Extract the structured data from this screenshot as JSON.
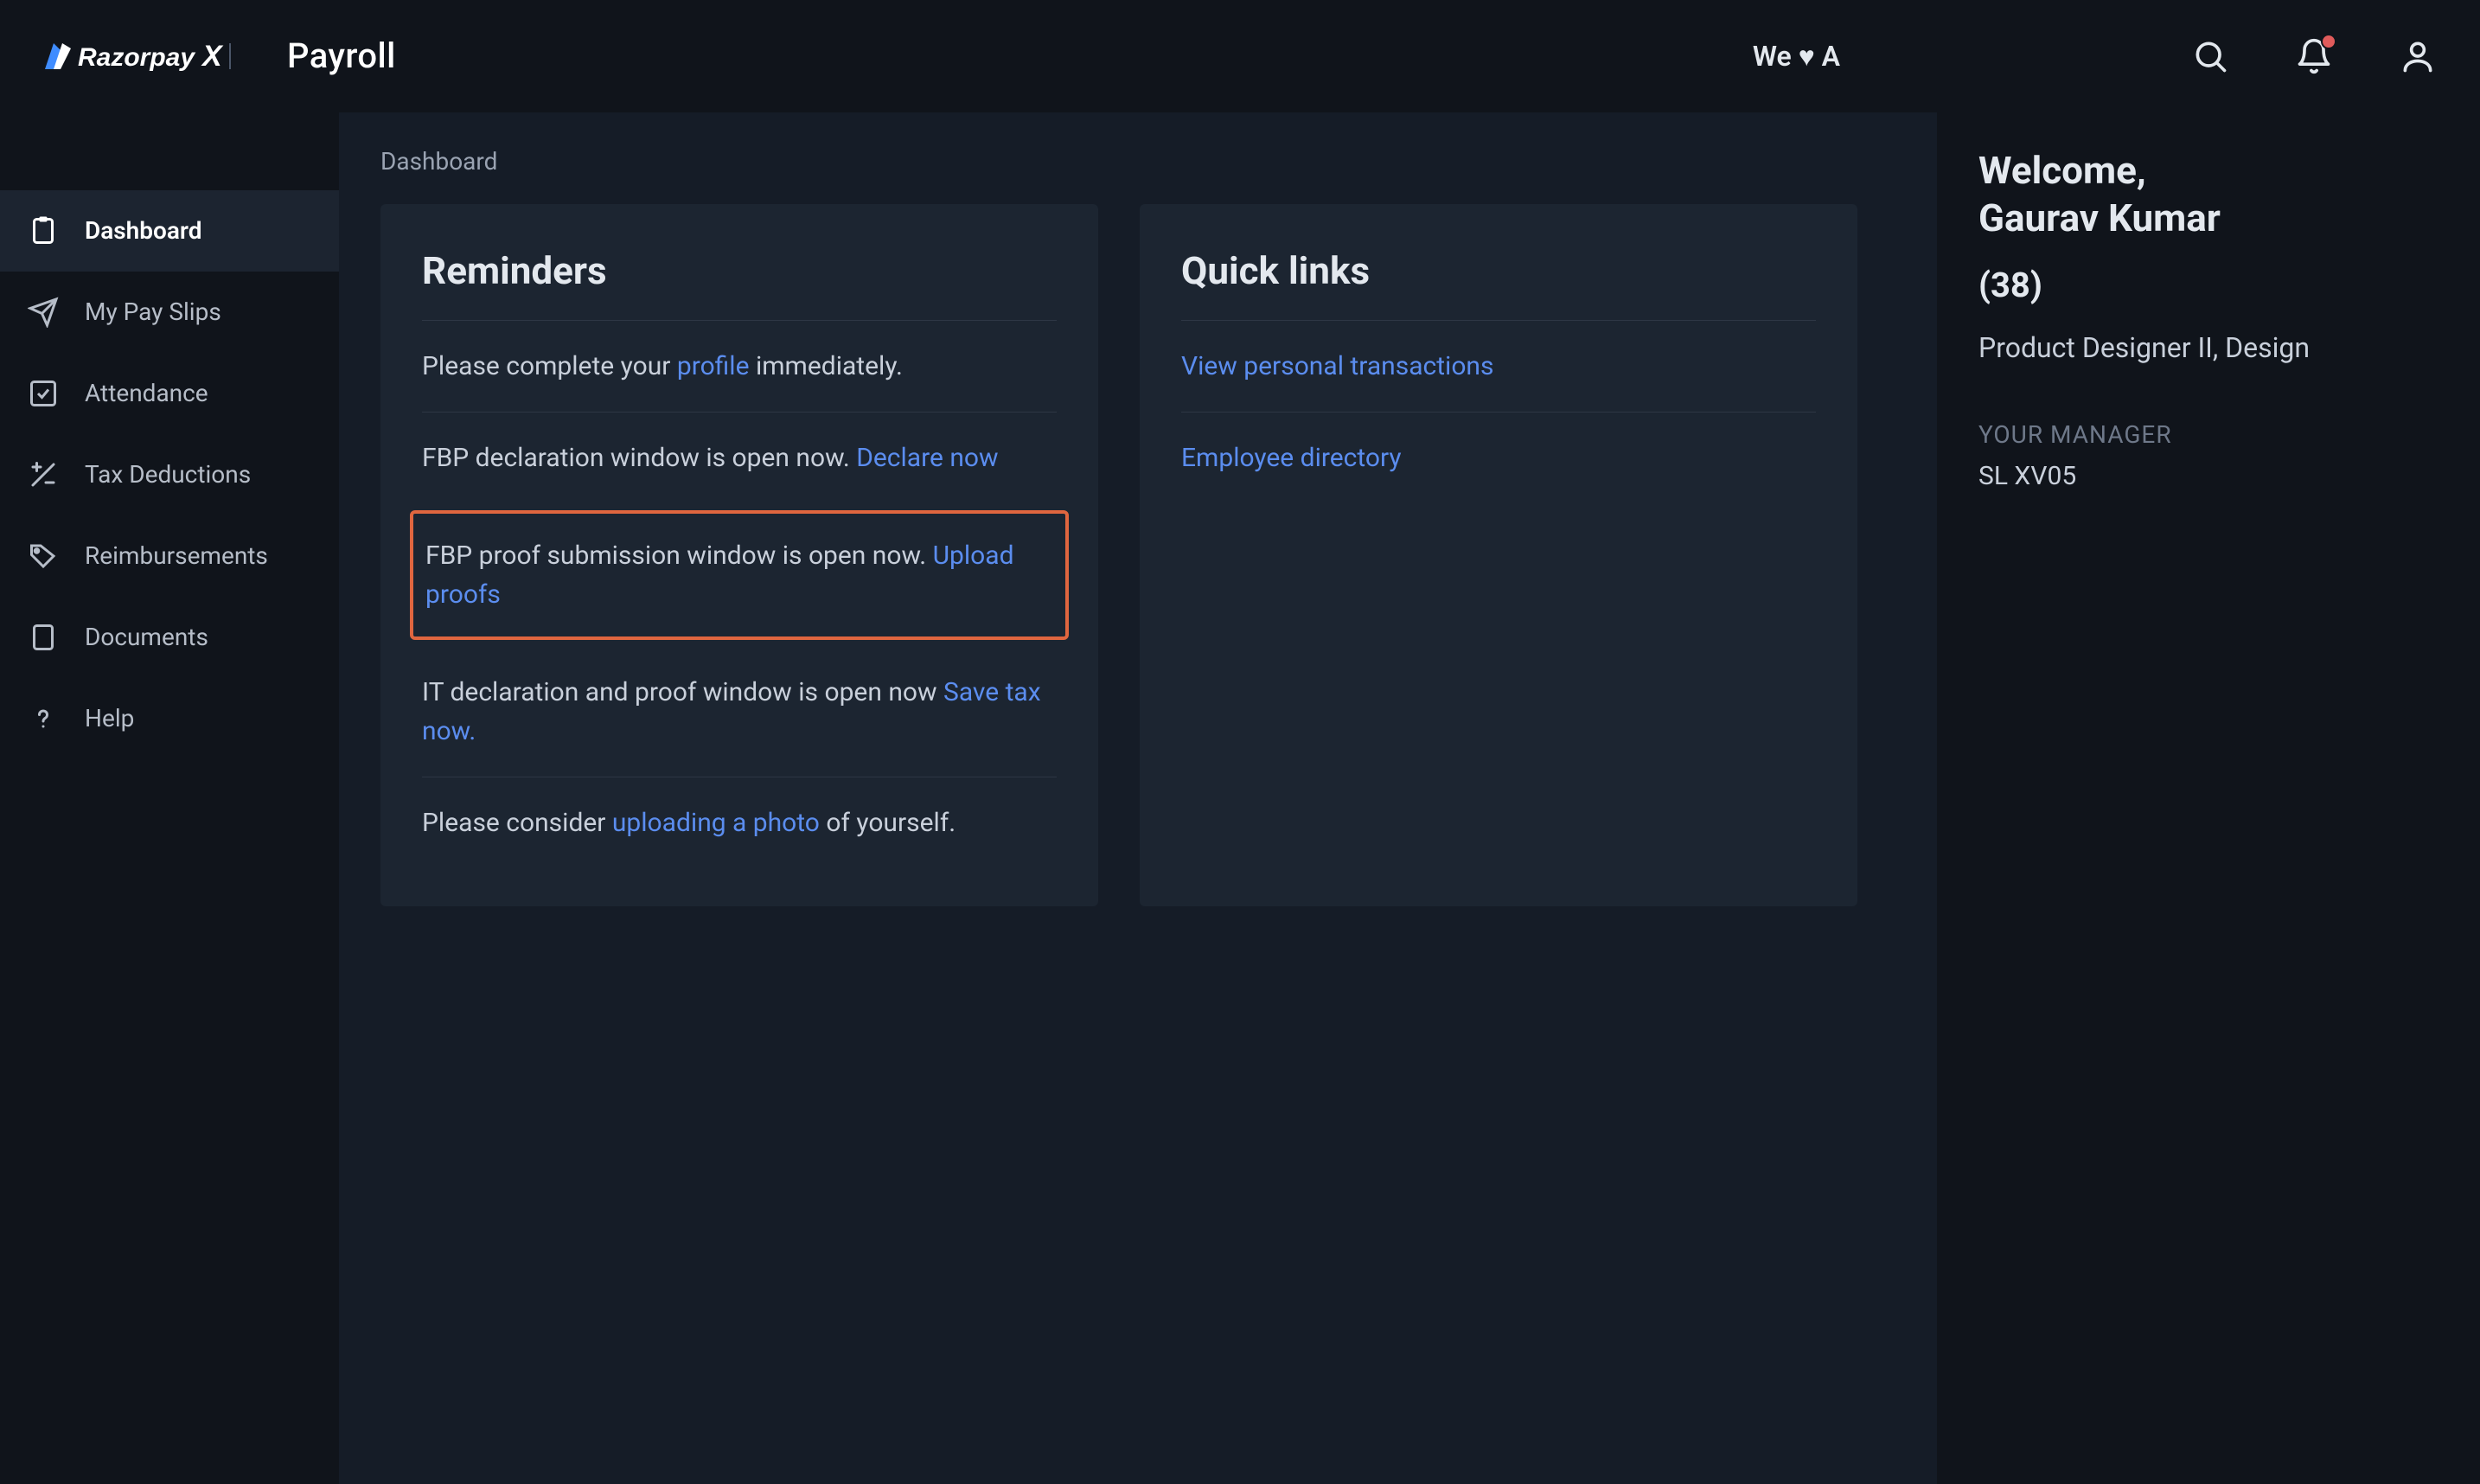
{
  "header": {
    "payroll_word": "Payroll",
    "heart_text": "We ♥ A"
  },
  "sidebar": {
    "items": [
      {
        "label": "Dashboard"
      },
      {
        "label": "My Pay Slips"
      },
      {
        "label": "Attendance"
      },
      {
        "label": "Tax Deductions"
      },
      {
        "label": "Reimbursements"
      },
      {
        "label": "Documents"
      },
      {
        "label": "Help"
      }
    ]
  },
  "breadcrumb": "Dashboard",
  "reminders": {
    "title": "Reminders",
    "r1_pre": "Please complete your ",
    "r1_link": "profile",
    "r1_post": " immediately.",
    "r2_pre": "FBP declaration window is open now. ",
    "r2_link": "Declare now",
    "r3_pre": "FBP proof submission window is open now. ",
    "r3_link": "Upload proofs",
    "r4_pre": "IT declaration and proof window is open now ",
    "r4_link": "Save tax now.",
    "r5_pre": "Please consider ",
    "r5_link": "uploading a photo",
    "r5_post": " of yourself."
  },
  "quicklinks": {
    "title": "Quick links",
    "l1": "View personal transactions",
    "l2": "Employee directory"
  },
  "profile": {
    "welcome": "Welcome,",
    "name": "Gaurav Kumar",
    "id": "(38)",
    "role": "Product Designer II, Design",
    "manager_label": "YOUR MANAGER",
    "manager_name": "SL XV05"
  }
}
